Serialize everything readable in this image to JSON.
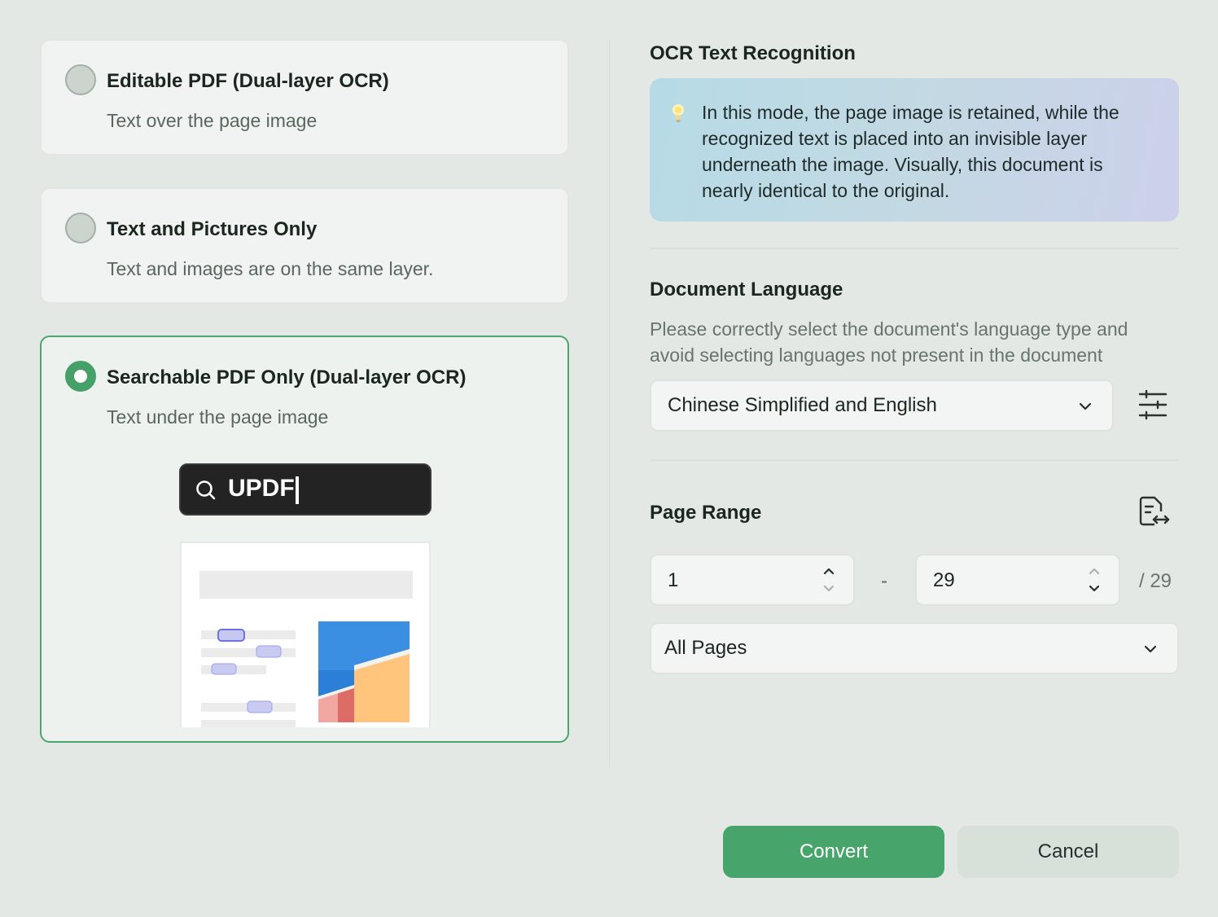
{
  "options": [
    {
      "title": "Editable PDF (Dual-layer OCR)",
      "subtitle": "Text over the page image",
      "selected": false
    },
    {
      "title": "Text and Pictures Only",
      "subtitle": "Text and images are on the same layer.",
      "selected": false
    },
    {
      "title": "Searchable PDF Only (Dual-layer OCR)",
      "subtitle": "Text under the page image",
      "selected": true
    }
  ],
  "preview": {
    "search_text": "UPDF"
  },
  "ocr": {
    "title": "OCR Text Recognition",
    "info_icon": "lightbulb-icon",
    "info": "In this mode, the page image is retained, while the recognized text is placed into an invisible layer underneath the image. Visually, this document is nearly identical to the original."
  },
  "language": {
    "title": "Document Language",
    "description": "Please correctly select the document's language type and avoid selecting languages not present in the document",
    "selected": "Chinese Simplified and English",
    "settings_icon": "sliders-icon"
  },
  "page_range": {
    "title": "Page Range",
    "icon": "page-swap-icon",
    "from": "1",
    "separator": "-",
    "to": "29",
    "total": "/ 29",
    "preset": "All Pages"
  },
  "buttons": {
    "convert": "Convert",
    "cancel": "Cancel"
  },
  "colors": {
    "accent": "#47a56b",
    "info_gradient_start": "#b6dbe6",
    "info_gradient_end": "#ccd0ea"
  }
}
